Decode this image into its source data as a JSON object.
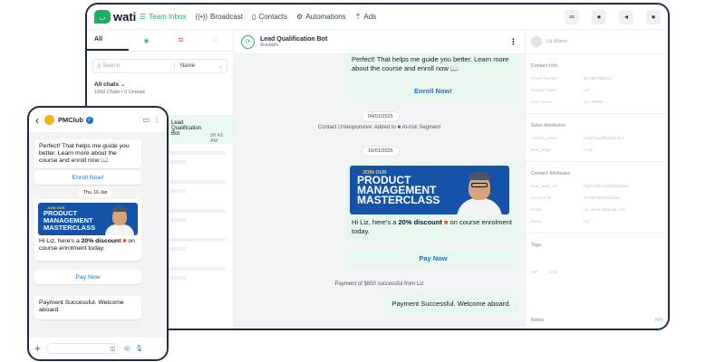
{
  "brand": {
    "name": "wati",
    "accent": "#1fae63"
  },
  "nav": [
    {
      "label": "Team Inbox",
      "icon": "inbox-icon",
      "glyph": "☰",
      "active": true
    },
    {
      "label": "Broadcast",
      "icon": "broadcast-icon",
      "glyph": "((•))",
      "active": false
    },
    {
      "label": "Contacts",
      "icon": "contacts-icon",
      "glyph": "▯",
      "active": false
    },
    {
      "label": "Automations",
      "icon": "automations-icon",
      "glyph": "⚙",
      "active": false
    },
    {
      "label": "Ads",
      "icon": "ads-icon",
      "glyph": "⇡",
      "active": false
    }
  ],
  "inbox": {
    "tab_all": "All",
    "search_placeholder": "Search",
    "filter_label": "Name",
    "all_chats": "All chats",
    "counts": "1669 Chats  •  0 Unread",
    "today": "Today",
    "selected_chat": {
      "title": "Lead Qualification Bot",
      "time": "08:43 AM"
    }
  },
  "chat": {
    "bot_name": "Lead Qualification Bot",
    "bot_status": "Available",
    "msg_intro": "Perfect! That helps me guide you better. Learn more about the course and enroll now 📖",
    "enroll_btn": "Enroll Now!",
    "date1": "04/01/2025",
    "sys1_pre": "Contact Unresponsive: Added to",
    "sys1_post": "At-risk Segment",
    "date2": "16/01/2025",
    "banner_join": "JOIN OUR",
    "banner_l1": "PRODUCT",
    "banner_l2": "MANAGEMENT",
    "banner_l3": "MASTERCLASS",
    "offer_pre": "Hi Liz, here's a",
    "offer_bold": "20% discount",
    "offer_post": "on course enrolment today.",
    "pay_btn": "Pay Now",
    "sys2": "Payment of $650 successful from Liz",
    "payment_msg": "Payment Successful. Welcome aboard."
  },
  "phone": {
    "contact": "PMClub",
    "msg_intro": "Perfect! That helps me guide you better. Learn more about the course and enroll now 📖",
    "enroll_btn": "Enroll Now!",
    "date": "Thu, 16 Jan",
    "banner_join": "JOIN OUR",
    "banner_l1": "PRODUCT",
    "banner_l2": "MANAGEMENT",
    "banner_l3": "MASTERCLASS",
    "offer_pre": "Hi Liz, here's a",
    "offer_bold": "20% discount",
    "offer_post": "on course enrolment today.",
    "pay_btn": "Pay Now",
    "payment_msg": "Payment Successful. Welcome aboard."
  },
  "profile": {
    "name": "Liz Wilson",
    "contact_info": "Contact Info",
    "rows1": [
      {
        "k": "Phone Number",
        "v": "91 1987654210"
      },
      {
        "k": "Display Name",
        "v": "Liz"
      },
      {
        "k": "User Name",
        "v": "Liz_Wilson"
      }
    ],
    "sales_attr": "Sales Attributes",
    "rows2": [
      {
        "k": "contact_owner",
        "v": "Lead Qualification Bot"
      },
      {
        "k": "lead_stage",
        "v": "Cold"
      }
    ],
    "contact_attr": "Contact Attributes",
    "rows3": [
      {
        "k": "lead_page_url",
        "v": "https://lnk.me/8001150xx"
      },
      {
        "k": "Account ID",
        "v": "2746573769214165"
      },
      {
        "k": "Email",
        "v": "Liz_wilson@gmail.com"
      },
      {
        "k": "Name",
        "v": "Liz"
      }
    ],
    "tags": "Tags",
    "tag_vip": "VIP",
    "tag_lead": "Lead",
    "notes": "Notes",
    "add": "Add"
  }
}
